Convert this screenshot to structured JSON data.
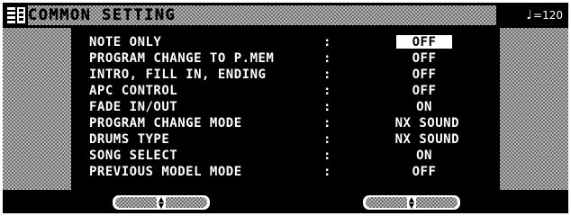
{
  "title": "COMMON SETTING",
  "tempo": {
    "note_glyph": "♩",
    "value": "=120"
  },
  "settings": [
    {
      "label": "NOTE ONLY",
      "value": "OFF",
      "selected": true
    },
    {
      "label": "PROGRAM CHANGE TO P.MEM",
      "value": "OFF",
      "selected": false
    },
    {
      "label": "INTRO, FILL IN, ENDING",
      "value": "OFF",
      "selected": false
    },
    {
      "label": "APC CONTROL",
      "value": "OFF",
      "selected": false
    },
    {
      "label": "FADE IN/OUT",
      "value": "ON",
      "selected": false
    },
    {
      "label": "PROGRAM CHANGE MODE",
      "value": "NX SOUND",
      "selected": false
    },
    {
      "label": "DRUMS TYPE",
      "value": "NX SOUND",
      "selected": false
    },
    {
      "label": "SONG SELECT",
      "value": "ON",
      "selected": false
    },
    {
      "label": "PREVIOUS MODEL MODE",
      "value": "OFF",
      "selected": false
    }
  ],
  "separator": ":",
  "buttons": {
    "left_icon": "up-down-arrows-icon",
    "right_icon": "up-down-arrows-icon"
  },
  "colors": {
    "background": "#000000",
    "text": "#ffffff",
    "dither_dark": "#6e6e6e",
    "dither_light": "#b5b5b5"
  }
}
